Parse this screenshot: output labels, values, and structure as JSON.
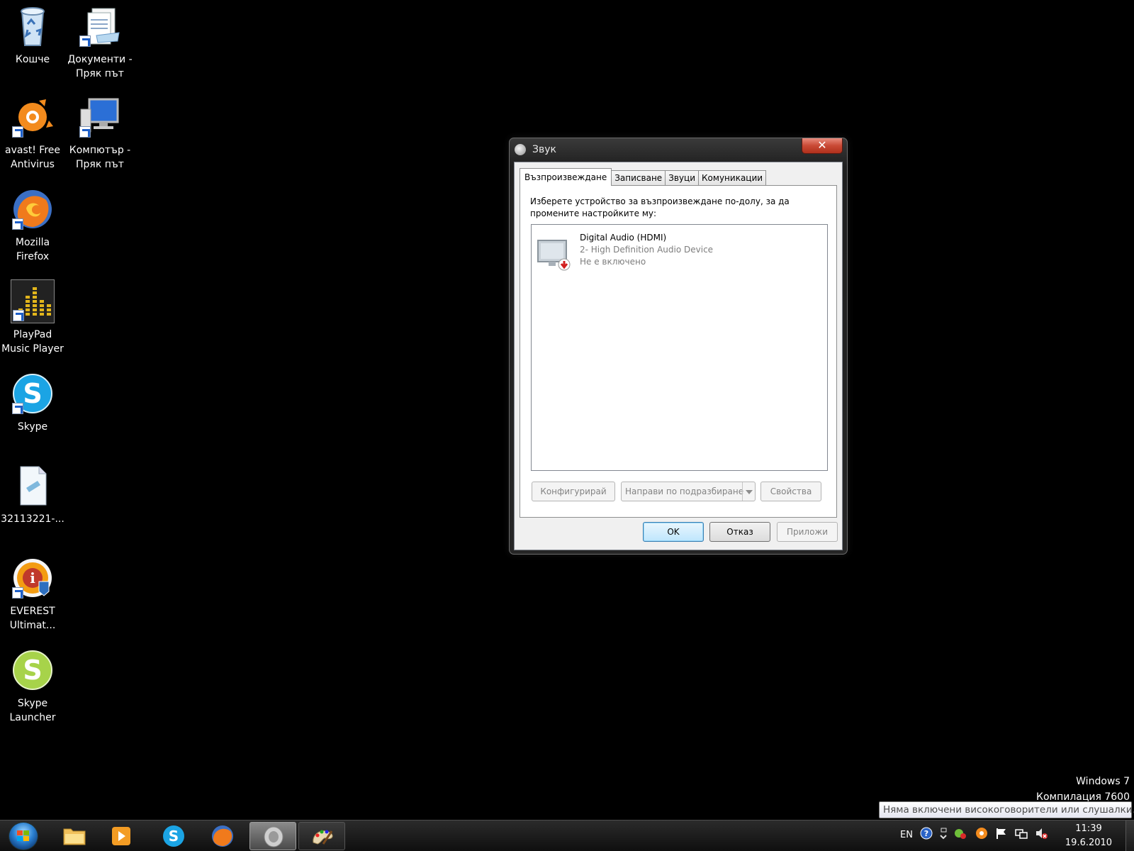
{
  "desktop": {
    "icons": [
      {
        "label": "Кошче"
      },
      {
        "label": "Документи - Пряк път"
      },
      {
        "label": "avast! Free Antivirus"
      },
      {
        "label": "Компютър - Пряк път"
      },
      {
        "label": "Mozilla Firefox"
      },
      {
        "label": "PlayPad Music Player"
      },
      {
        "label": "Skype"
      },
      {
        "label": "32113221-..."
      },
      {
        "label": "EVEREST Ultimat..."
      },
      {
        "label": "Skype Launcher"
      }
    ]
  },
  "dialog": {
    "title": "Звук",
    "close_label": "✕",
    "tabs": [
      {
        "label": "Възпроизвеждане",
        "active": true
      },
      {
        "label": "Записване"
      },
      {
        "label": "Звуци"
      },
      {
        "label": "Комуникации"
      }
    ],
    "instruction": "Изберете устройство за възпроизвеждане по-долу, за да промените настройките му:",
    "device": {
      "name": "Digital Audio (HDMI)",
      "driver": "2- High Definition Audio Device",
      "status": "Не е включено"
    },
    "buttons": {
      "configure": "Конфигурирай",
      "set_default": "Направи по подразбиране",
      "properties": "Свойства",
      "ok": "OK",
      "cancel": "Отказ",
      "apply": "Приложи"
    }
  },
  "watermark": {
    "line1": "Windows 7",
    "line2": "Компилация 7600"
  },
  "tooltip": "Няма включени високоговорители или слушалки.",
  "taskbar": {
    "language": "EN",
    "time": "11:39",
    "date": "19.6.2010 г."
  }
}
